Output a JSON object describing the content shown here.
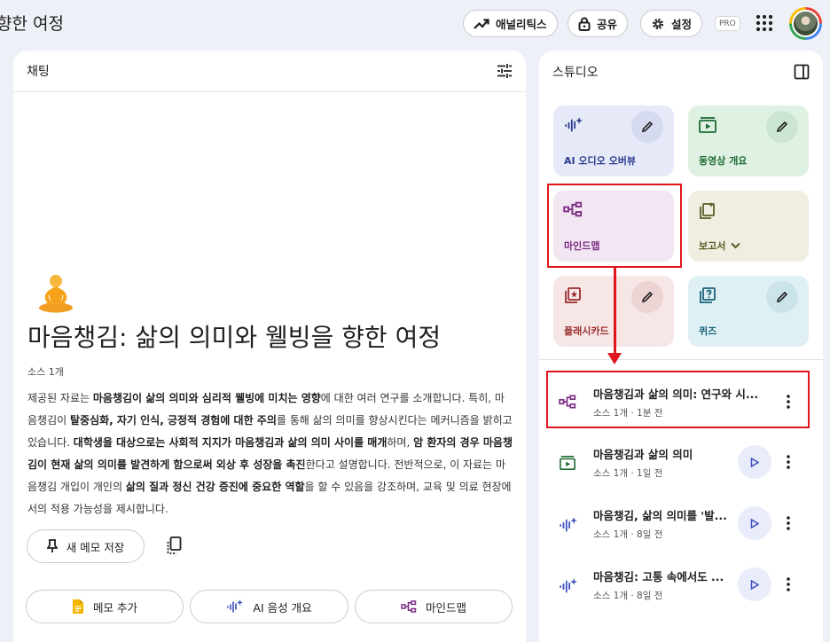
{
  "header": {
    "title": "향한 여정",
    "analytics_label": "애널리틱스",
    "share_label": "공유",
    "settings_label": "설정",
    "pro_badge": "PRO"
  },
  "chat": {
    "panel_title": "채팅",
    "notebook_title": "마음챙김: 삶의 의미와 웰빙을 향한 여정",
    "source_count": "소스 1개",
    "summary_segments": [
      {
        "text": "제공된 자료는 ",
        "bold": false
      },
      {
        "text": "마음챙김이 삶의 의미와 심리적 웰빙에 미치는 영향",
        "bold": true
      },
      {
        "text": "에 대한 여러 연구를 소개합니다. 특히, 마음챙김이 ",
        "bold": false
      },
      {
        "text": "탈중심화, 자기 인식, 긍정적 경험에 대한 주의",
        "bold": true
      },
      {
        "text": "를 통해 삶의 의미를 향상시킨다는 메커니즘을 밝히고 있습니다. ",
        "bold": false
      },
      {
        "text": "대학생을 대상으로는 사회적 지지가 마음챙김과 삶의 의미 사이를 매개",
        "bold": true
      },
      {
        "text": "하며, ",
        "bold": false
      },
      {
        "text": "암 환자의 경우 마음챙김이 현재 삶의 의미를 발견하게 함으로써 외상 후 성장을 촉진",
        "bold": true
      },
      {
        "text": "한다고 설명합니다. 전반적으로, 이 자료는 마음챙김 개입이 개인의 ",
        "bold": false
      },
      {
        "text": "삶의 질과 정신 건강 증진에 중요한 역할",
        "bold": true
      },
      {
        "text": "을 할 수 있음을 강조하며, 교육 및 의료 현장에서의 적용 가능성을 제시합니다.",
        "bold": false
      }
    ],
    "save_note_label": "새 메모 저장",
    "actions": [
      {
        "label": "메모 추가",
        "icon": "note-icon"
      },
      {
        "label": "AI 음성 개요",
        "icon": "audio-sparkle-icon"
      },
      {
        "label": "마인드맵",
        "icon": "mindmap-icon"
      }
    ]
  },
  "studio": {
    "panel_title": "스튜디오",
    "cards": [
      {
        "label": "AI 오디오 오버뷰",
        "icon": "audio-sparkle-icon",
        "bg": "#e6e9f7",
        "color": "#2b3a8f"
      },
      {
        "label": "동영상 개요",
        "icon": "video-icon",
        "bg": "#dff1e3",
        "color": "#1e6b34"
      },
      {
        "label": "마인드맵",
        "icon": "mindmap-icon",
        "bg": "#f1e6f1",
        "color": "#7b2b84"
      },
      {
        "label": "보고서",
        "icon": "report-icon",
        "bg": "#efeee0",
        "color": "#5e5a25"
      },
      {
        "label": "플래시카드",
        "icon": "flashcard-icon",
        "bg": "#f7e6e6",
        "color": "#9a2d2d"
      },
      {
        "label": "퀴즈",
        "icon": "quiz-icon",
        "bg": "#dff0f5",
        "color": "#1b6277"
      }
    ],
    "outputs": [
      {
        "title": "마음챙김과 삶의 의미: 연구와 시...",
        "meta": "소스 1개 · 1분 전",
        "icon": "mindmap-icon"
      },
      {
        "title": "마음챙김과 삶의 의미",
        "meta": "소스 1개 · 1일 전",
        "icon": "video-icon"
      },
      {
        "title": "마음챙김, 삶의 의미를 '발...",
        "meta": "소스 1개 · 8일 전",
        "icon": "audio-sparkle-icon"
      },
      {
        "title": "마음챙김: 고통 속에서도 ...",
        "meta": "소스 1개 · 8일 전",
        "icon": "audio-sparkle-icon"
      }
    ]
  },
  "colors": {
    "highlight": "#e0141c",
    "accent": "#3b4cc0"
  }
}
